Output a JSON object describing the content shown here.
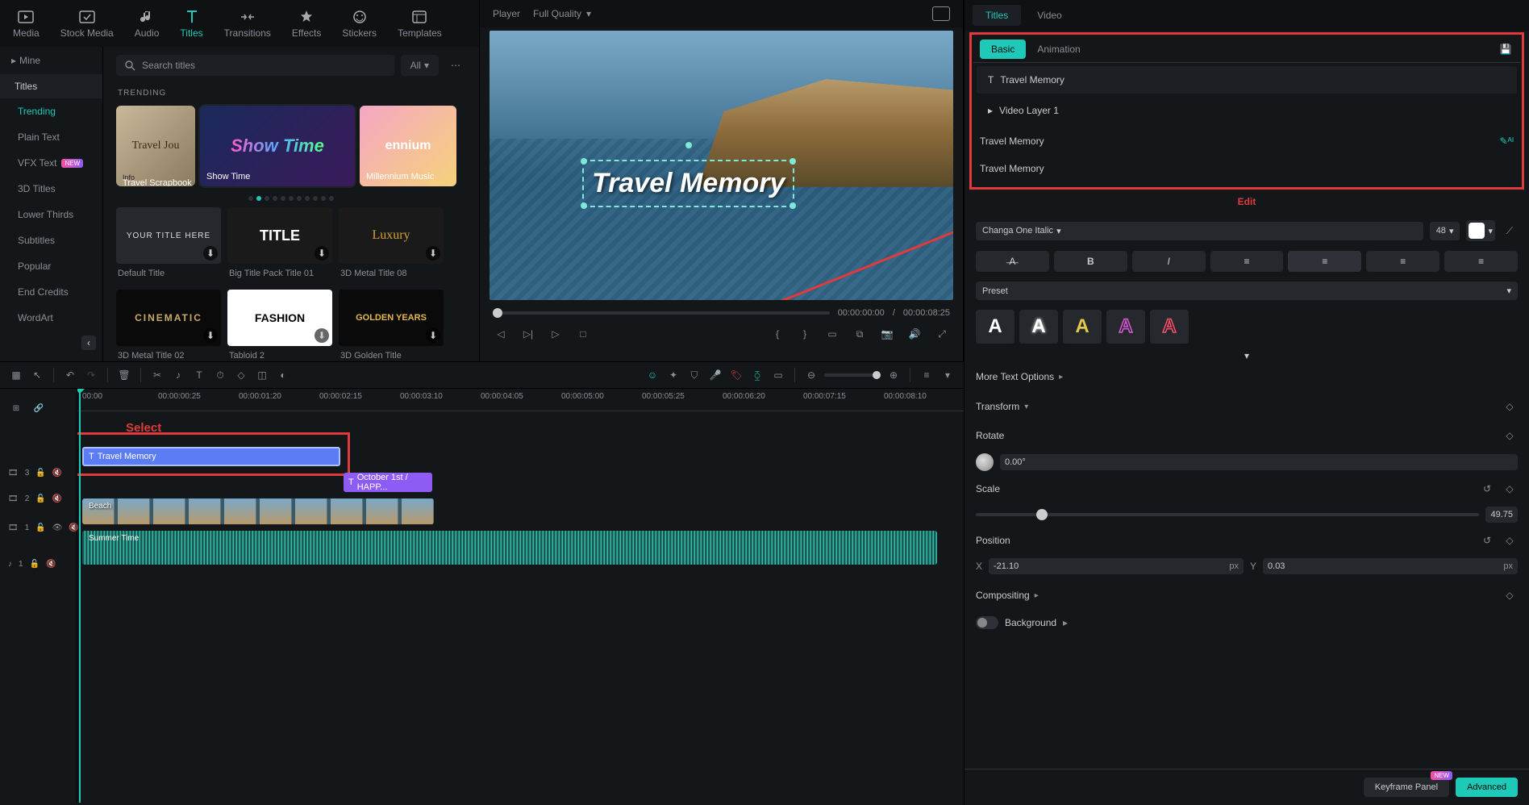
{
  "topnav": [
    {
      "id": "media",
      "label": "Media"
    },
    {
      "id": "stock",
      "label": "Stock Media"
    },
    {
      "id": "audio",
      "label": "Audio"
    },
    {
      "id": "titles",
      "label": "Titles"
    },
    {
      "id": "transitions",
      "label": "Transitions"
    },
    {
      "id": "effects",
      "label": "Effects"
    },
    {
      "id": "stickers",
      "label": "Stickers"
    },
    {
      "id": "templates",
      "label": "Templates"
    }
  ],
  "left": {
    "mine": "Mine",
    "titles_header": "Titles",
    "categories": [
      "Trending",
      "Plain Text",
      "VFX Text",
      "3D Titles",
      "Lower Thirds",
      "Subtitles",
      "Popular",
      "End Credits",
      "WordArt"
    ],
    "search_placeholder": "Search titles",
    "filter": "All",
    "section": "TRENDING",
    "trending_cards": [
      "Travel Scrapbook",
      "Show Time",
      "Millennium Music"
    ],
    "info_badge": "Info",
    "grid": [
      {
        "title": "Default Title",
        "render": "YOUR TITLE HERE"
      },
      {
        "title": "Big Title Pack Title 01",
        "render": "TITLE"
      },
      {
        "title": "3D Metal Title 08",
        "render": "Luxury"
      },
      {
        "title": "3D Metal Title 02",
        "render": "CINEMATIC"
      },
      {
        "title": "Tabloid 2",
        "render": "FASHION"
      },
      {
        "title": "3D Golden Title",
        "render": "GOLDEN YEARS"
      }
    ]
  },
  "player": {
    "label": "Player",
    "quality": "Full Quality",
    "overlay_text": "Travel Memory",
    "time_current": "00:00:00:00",
    "time_total": "00:00:08:25",
    "sep": "/"
  },
  "timeline": {
    "ticks": [
      "00:00",
      "00:00:00:25",
      "00:00:01:20",
      "00:00:02:15",
      "00:00:03:10",
      "00:00:04:05",
      "00:00:05:00",
      "00:00:05:25",
      "00:00:06:20",
      "00:00:07:15",
      "00:00:08:10"
    ],
    "tracks": {
      "t3": {
        "head": "3",
        "clip": "Travel Memory"
      },
      "t2": {
        "head": "2",
        "clip": "October 1st / HAPP..."
      },
      "t1": {
        "head": "1",
        "clip": "Beach"
      },
      "a1": {
        "head": "1",
        "clip": "Summer Time"
      }
    },
    "annot_select": "Select"
  },
  "right": {
    "tabs": [
      "Titles",
      "Video"
    ],
    "subtabs": [
      "Basic",
      "Animation"
    ],
    "layers": [
      "Travel Memory",
      "Video Layer 1"
    ],
    "group_title": "Travel Memory",
    "text_value": "Travel Memory",
    "annot_edit": "Edit",
    "font": "Changa One Italic",
    "size": "48",
    "preset_label": "Preset",
    "more_text": "More Text Options",
    "transform": "Transform",
    "rotate": {
      "label": "Rotate",
      "value": "0.00°"
    },
    "scale": {
      "label": "Scale",
      "value": "49.75"
    },
    "position": {
      "label": "Position",
      "x_label": "X",
      "x": "-21.10",
      "y_label": "Y",
      "y": "0.03",
      "unit": "px"
    },
    "compositing": "Compositing",
    "background": "Background",
    "footer": {
      "keyframe": "Keyframe Panel",
      "advanced": "Advanced"
    }
  }
}
